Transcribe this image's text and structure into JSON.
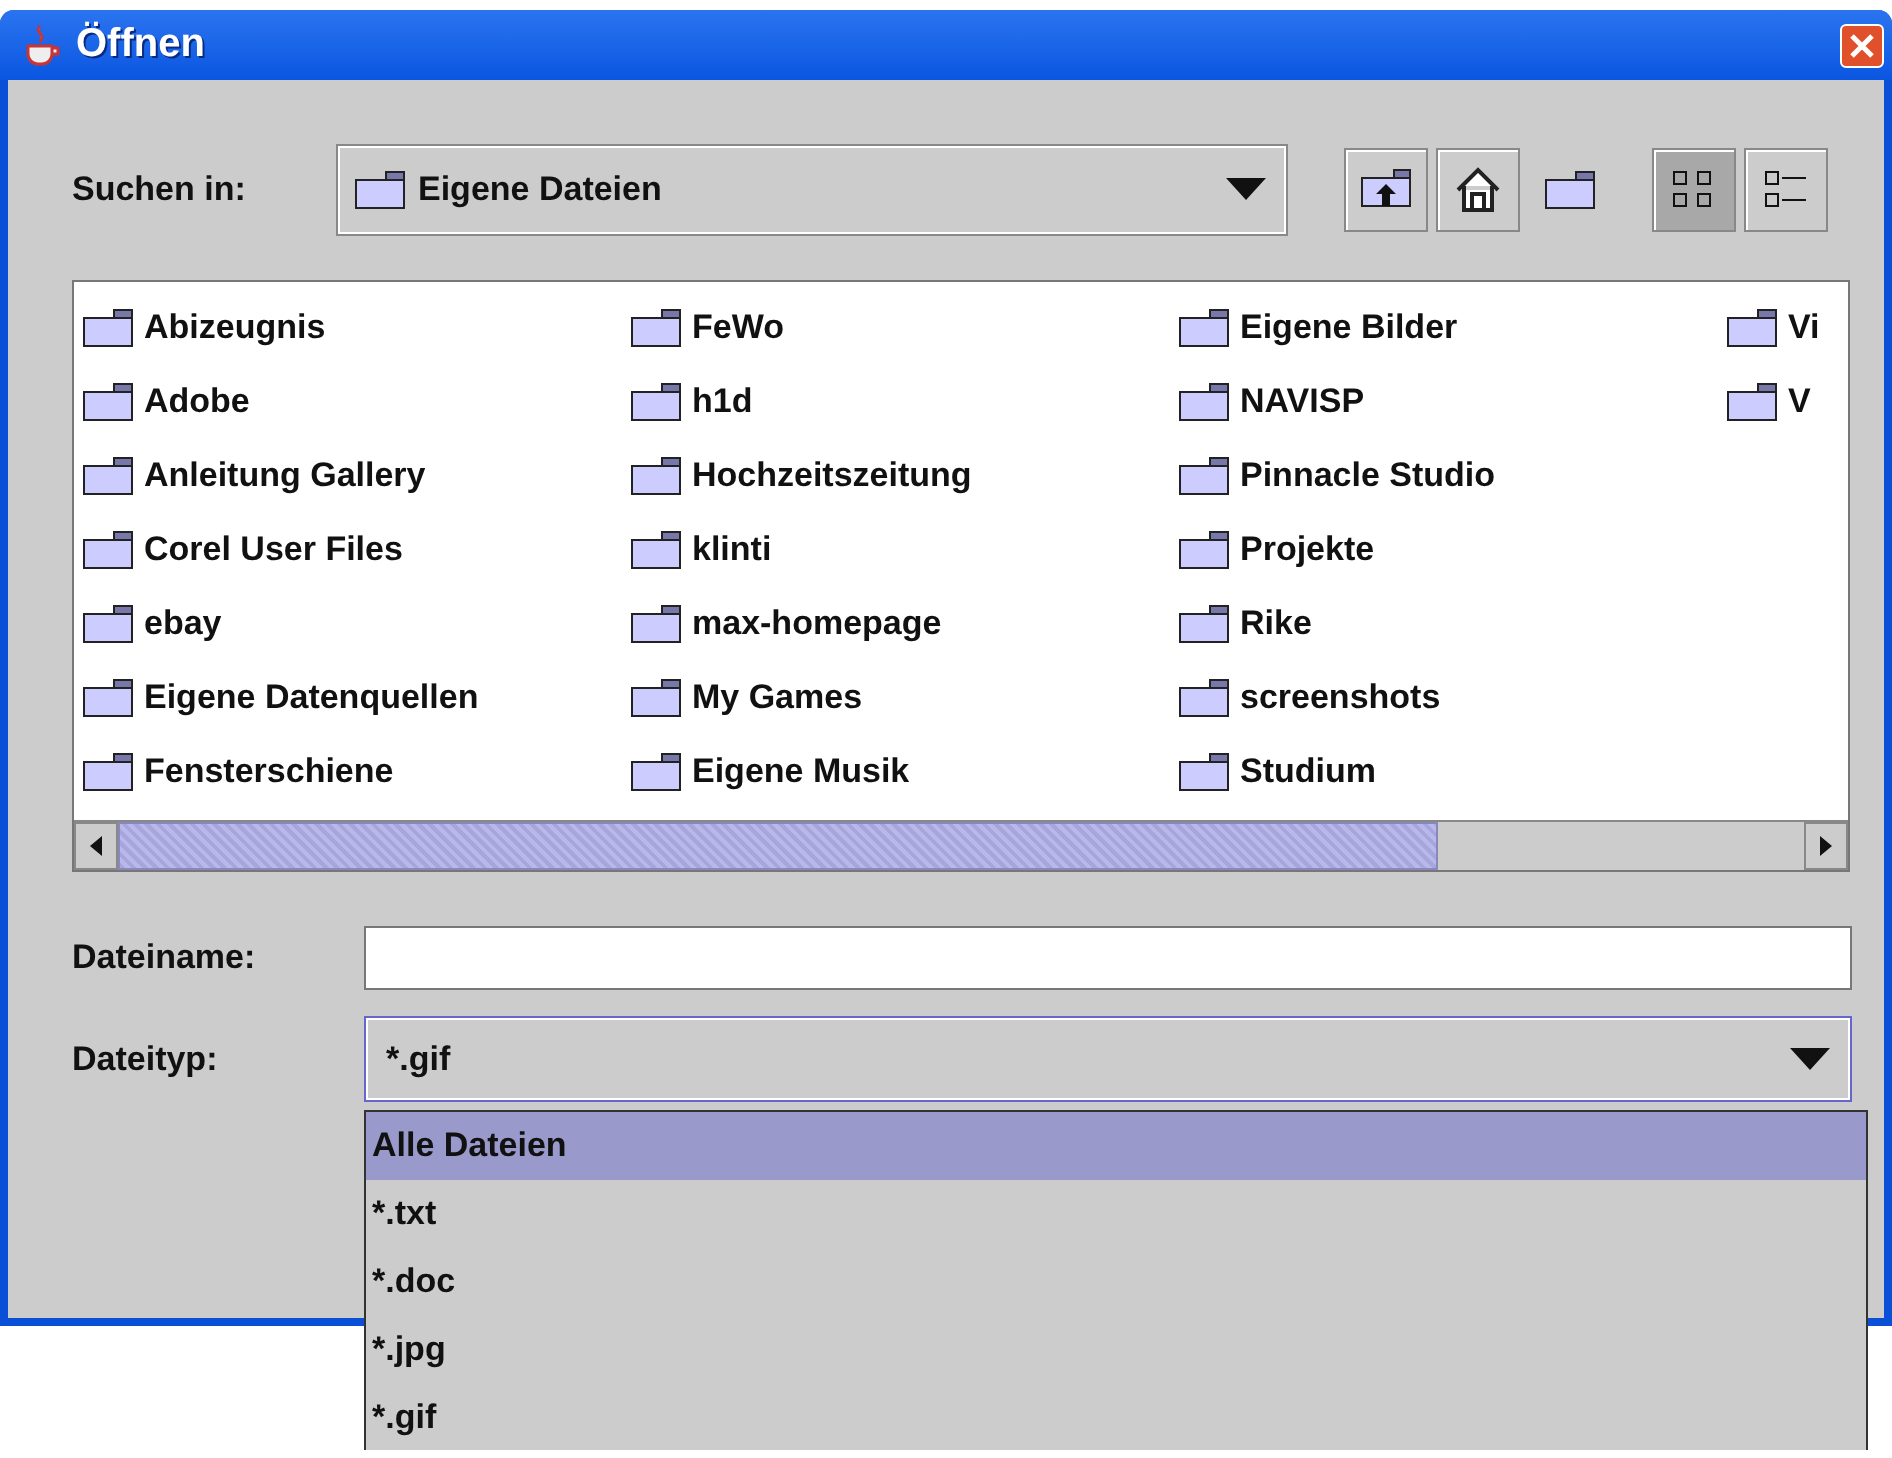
{
  "window": {
    "title": "Öffnen"
  },
  "look_in": {
    "label": "Suchen in:",
    "value": "Eigene Dateien"
  },
  "toolbar": [
    {
      "kind": "up",
      "selected": false
    },
    {
      "kind": "home",
      "selected": false
    },
    {
      "kind": "newfolder",
      "selected": false
    },
    {
      "kind": "list",
      "selected": true
    },
    {
      "kind": "details",
      "selected": false
    }
  ],
  "files": [
    "Abizeugnis",
    "Adobe",
    "Anleitung Gallery",
    "Corel User Files",
    "ebay",
    "Eigene Datenquellen",
    "Fensterschiene",
    "FeWo",
    "h1d",
    "Hochzeitszeitung",
    "klinti",
    "max-homepage",
    "My Games",
    "Eigene Musik",
    "Eigene Bilder",
    "NAVISP",
    "Pinnacle Studio",
    "Projekte",
    "Rike",
    "screenshots",
    "Studium",
    "Vi",
    "V"
  ],
  "file_name": {
    "label": "Dateiname:"
  },
  "file_type": {
    "label": "Dateityp:",
    "value": "*.gif",
    "expanded": true
  },
  "file_type_options": [
    {
      "label": "Alle Dateien",
      "selected": true
    },
    {
      "label": "*.txt",
      "selected": false
    },
    {
      "label": "*.doc",
      "selected": false
    },
    {
      "label": "*.jpg",
      "selected": false
    },
    {
      "label": "*.gif",
      "selected": false
    }
  ]
}
